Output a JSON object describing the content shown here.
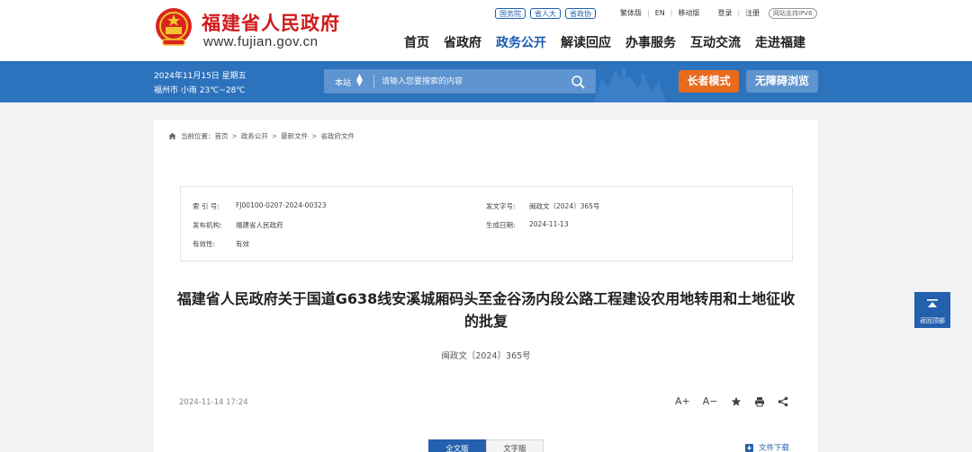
{
  "header": {
    "site_name": "福建省人民政府",
    "site_url": "www.fujian.gov.cn",
    "pills": [
      "国务院",
      "省人大",
      "省政协"
    ],
    "top_links": [
      "繁体版",
      "EN",
      "移动版",
      "登录",
      "注册"
    ],
    "ipv6": "网站支持IPV6",
    "nav": [
      "首页",
      "省政府",
      "政务公开",
      "解读回应",
      "办事服务",
      "互动交流",
      "走进福建"
    ],
    "nav_active": "政务公开",
    "brand_color": "#cf1b1b",
    "accent_color": "#1a5cb0"
  },
  "band": {
    "date": "2024年11月15日 星期五",
    "weather": "福州市 小雨 23℃~28℃",
    "search_scope": "本站",
    "search_placeholder": "请输入您要搜索的内容",
    "elder_mode": "长者模式",
    "accessibility": "无障碍浏览",
    "band_color": "#2d72bd",
    "elder_color": "#e86b1f"
  },
  "breadcrumb": {
    "prefix": "当前位置：",
    "items": [
      "首页",
      "政务公开",
      "最新文件",
      "省政府文件"
    ]
  },
  "meta": {
    "index_label": "索 引 号:",
    "index_value": "FJ00100-0207-2024-00323",
    "doc_no_label": "发文字号:",
    "doc_no_value": "闽政文〔2024〕365号",
    "org_label": "发布机构:",
    "org_value": "福建省人民政府",
    "date_label": "生成日期:",
    "date_value": "2024-11-13",
    "validity_label": "有效性:",
    "validity_value": "有效"
  },
  "document": {
    "title": "福建省人民政府关于国道G638线安溪城厢码头至金谷汤内段公路工程建设农用地转用和土地征收的批复",
    "number": "闽政文〔2024〕365号",
    "publish_time": "2024-11-14 17:24"
  },
  "tools": {
    "font_increase": "A+",
    "font_decrease": "A−",
    "favorite_icon": "star-icon",
    "print_icon": "print-icon",
    "share_icon": "share-icon"
  },
  "tabs": [
    "全文版",
    "文字版"
  ],
  "tab_active": "全文版",
  "download": "文件下载",
  "back_top": "返回顶部"
}
